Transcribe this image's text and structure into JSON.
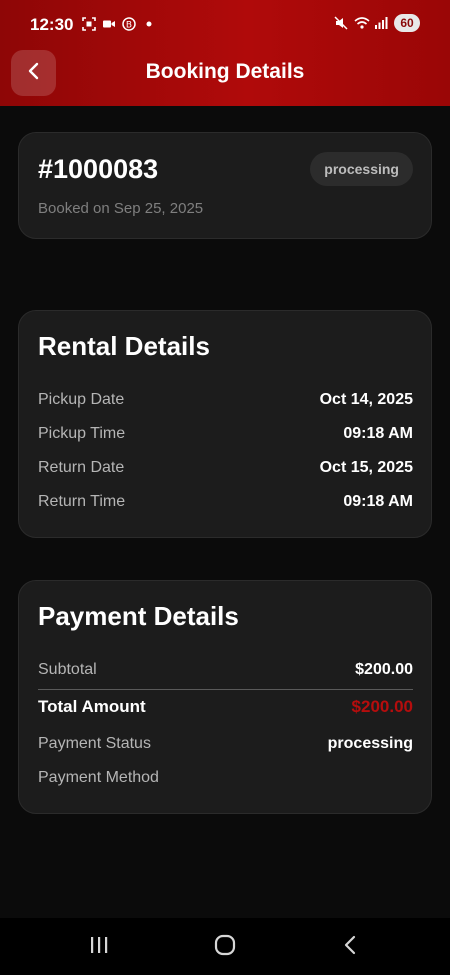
{
  "status_bar": {
    "time": "12:30",
    "left_icons": [
      "screenshot-icon",
      "video-icon",
      "accessibility-icon",
      "dot-icon"
    ],
    "right_icons": [
      "mute-icon",
      "wifi-icon",
      "signal-icon"
    ],
    "battery": "60"
  },
  "header": {
    "title": "Booking Details",
    "back_icon": "chevron-left-icon"
  },
  "booking": {
    "id": "#1000083",
    "status": "processing",
    "booked_on": "Booked on Sep 25, 2025"
  },
  "rental": {
    "title": "Rental Details",
    "rows": [
      {
        "label": "Pickup Date",
        "value": "Oct 14, 2025"
      },
      {
        "label": "Pickup Time",
        "value": "09:18 AM"
      },
      {
        "label": "Return Date",
        "value": "Oct 15, 2025"
      },
      {
        "label": "Return Time",
        "value": "09:18 AM"
      }
    ]
  },
  "payment": {
    "title": "Payment Details",
    "subtotal_label": "Subtotal",
    "subtotal_value": "$200.00",
    "total_label": "Total Amount",
    "total_value": "$200.00",
    "status_label": "Payment Status",
    "status_value": "processing",
    "method_label": "Payment Method",
    "method_value": ""
  },
  "colors": {
    "header_red": "#a00808",
    "total_red": "#b50d0d",
    "card_bg": "#1c1c1c",
    "page_bg": "#0b0b0b"
  },
  "nav": {
    "icons": [
      "recent-apps-icon",
      "home-icon",
      "back-icon"
    ]
  }
}
